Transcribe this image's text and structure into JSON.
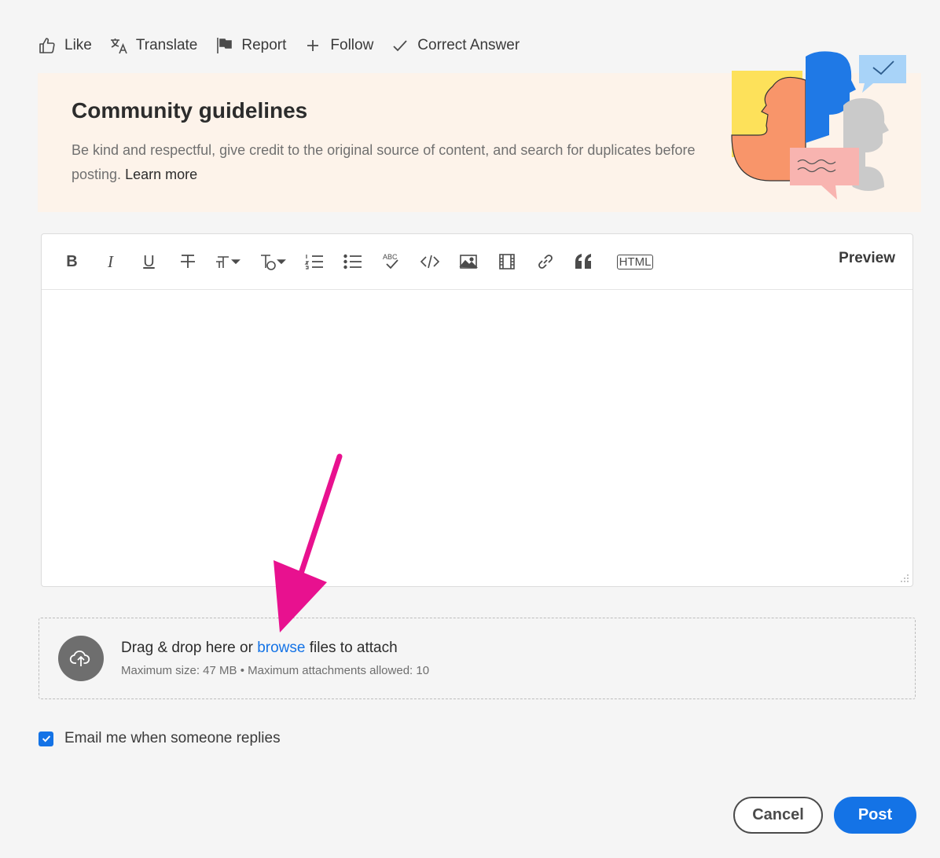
{
  "actions": [
    {
      "label": "Like",
      "icon": "thumbs-up-icon"
    },
    {
      "label": "Translate",
      "icon": "translate-icon"
    },
    {
      "label": "Report",
      "icon": "flag-icon"
    },
    {
      "label": "Follow",
      "icon": "plus-icon"
    },
    {
      "label": "Correct Answer",
      "icon": "checkmark-icon"
    }
  ],
  "guidelines": {
    "title": "Community guidelines",
    "text": "Be kind and respectful, give credit to the original source of content, and search for duplicates before posting.",
    "link": "Learn more"
  },
  "editor": {
    "tools": [
      "bold-icon",
      "italic-icon",
      "underline-icon",
      "strikethrough-icon",
      "font-size-icon",
      "font-style-icon",
      "numbered-list-icon",
      "bulleted-list-icon",
      "spellcheck-icon",
      "code-icon",
      "image-icon",
      "video-icon",
      "link-icon",
      "quote-icon",
      "html-icon"
    ],
    "bold_label": "B",
    "italic_label": "I",
    "underline_label": "U",
    "html_label": "HTML",
    "spell_label": "ABC",
    "preview": "Preview",
    "content": ""
  },
  "dropzone": {
    "prefix": "Drag & drop here or ",
    "browse": "browse",
    "suffix": " files to attach",
    "limits": "Maximum size: 47 MB • Maximum attachments allowed: 10"
  },
  "email_option": {
    "label": "Email me when someone replies",
    "checked": true
  },
  "buttons": {
    "cancel": "Cancel",
    "post": "Post"
  },
  "colors": {
    "accent": "#1473e6",
    "banner": "#fdf3ea",
    "annotation_arrow": "#e8118f"
  }
}
